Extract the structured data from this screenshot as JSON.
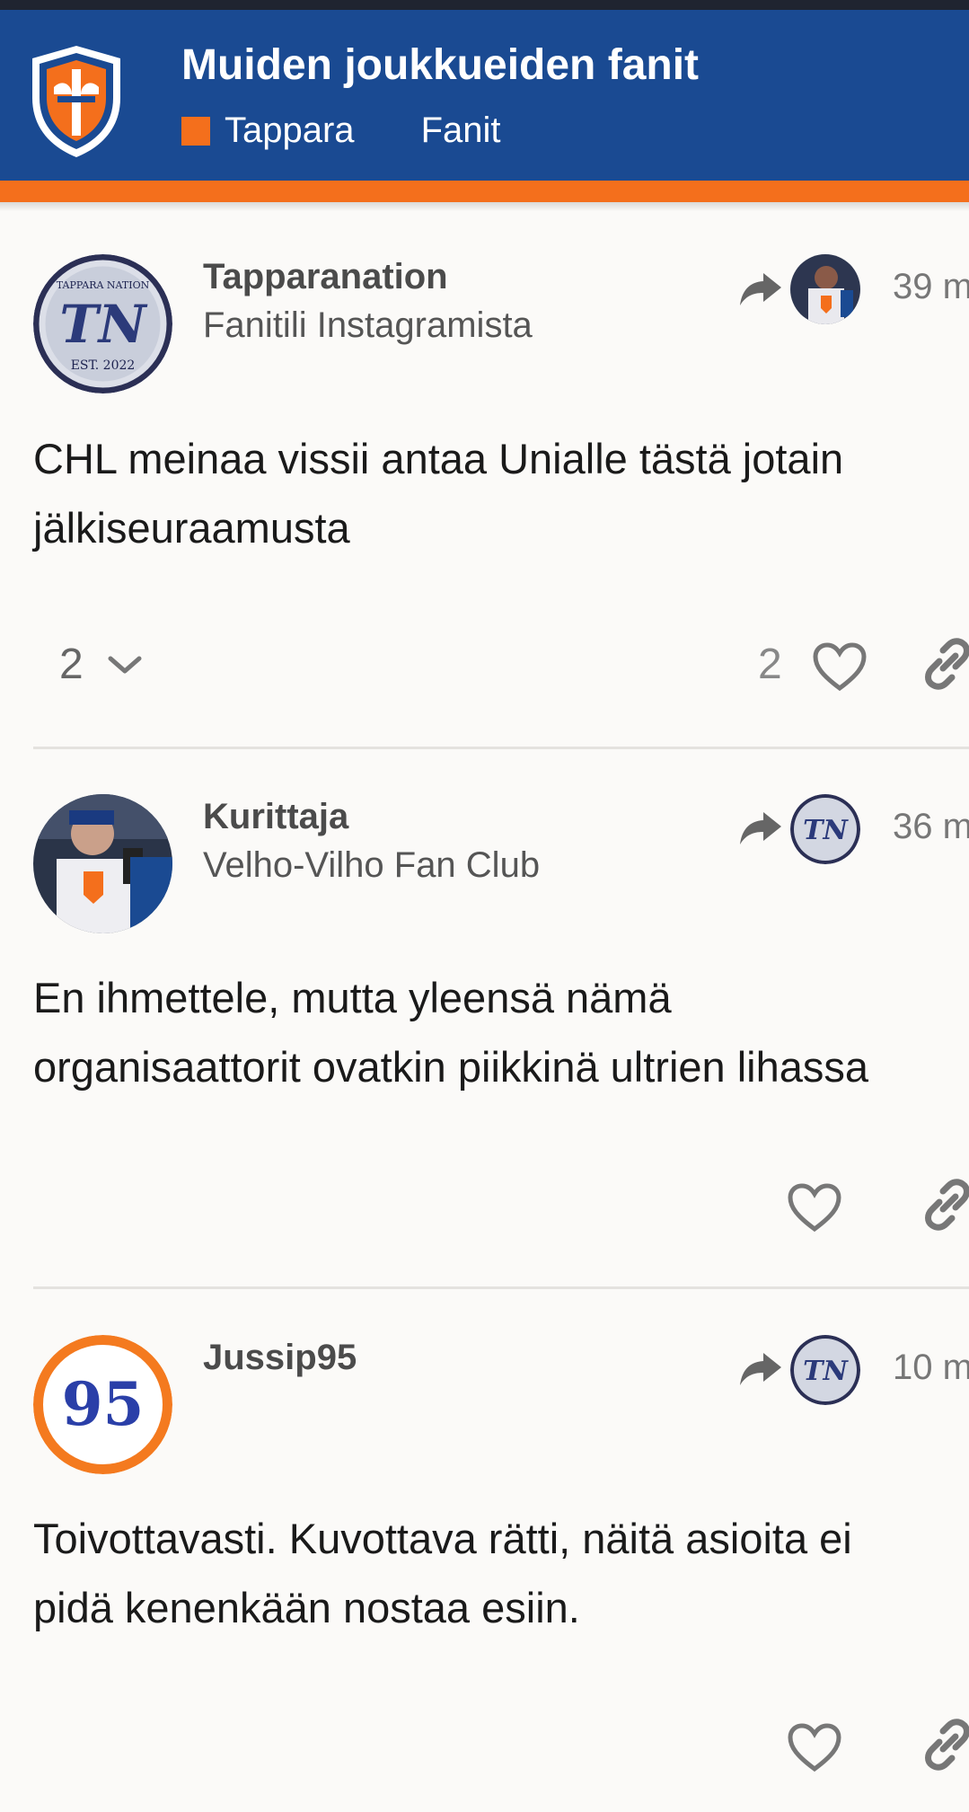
{
  "header": {
    "topic_title": "Muiden joukkueiden fanit",
    "category": "Tappara",
    "category_color": "#f46f1c",
    "tag": "Fanit",
    "background_color": "#1a4a92"
  },
  "posts": [
    {
      "username": "Tapparanation",
      "user_title": "Fanitili Instagramista",
      "avatar": "tn-logo-avatar",
      "avatar_text_top": "TAPPARA NATION",
      "avatar_text_mid": "TN",
      "avatar_text_bottom": "EST. 2022",
      "reply_to_avatar": "player-photo-avatar",
      "time": "39 m",
      "body_lines": [
        "CHL meinaa vissii antaa Unialle tästä jotain",
        "jälkiseuraamusta"
      ],
      "replies_count": "2",
      "likes_count": "2"
    },
    {
      "username": "Kurittaja",
      "user_title": "Velho-Vilho Fan Club",
      "avatar": "player-photo-avatar",
      "reply_to_avatar": "tn-logo-avatar",
      "reply_avatar_text": "TN",
      "time": "36 m",
      "body_lines": [
        "En ihmettele, mutta yleensä nämä",
        "organisaattorit ovatkin piikkinä ultrien lihassa"
      ]
    },
    {
      "username": "Jussip95",
      "user_title": "",
      "avatar": "number-95-avatar",
      "avatar_text": "95",
      "reply_to_avatar": "tn-logo-avatar",
      "reply_avatar_text": "TN",
      "time": "10 m",
      "body_lines": [
        "Toivottavasti. Kuvottava rätti, näitä asioita ei",
        "pidä kenenkään nostaa esiin."
      ]
    }
  ]
}
